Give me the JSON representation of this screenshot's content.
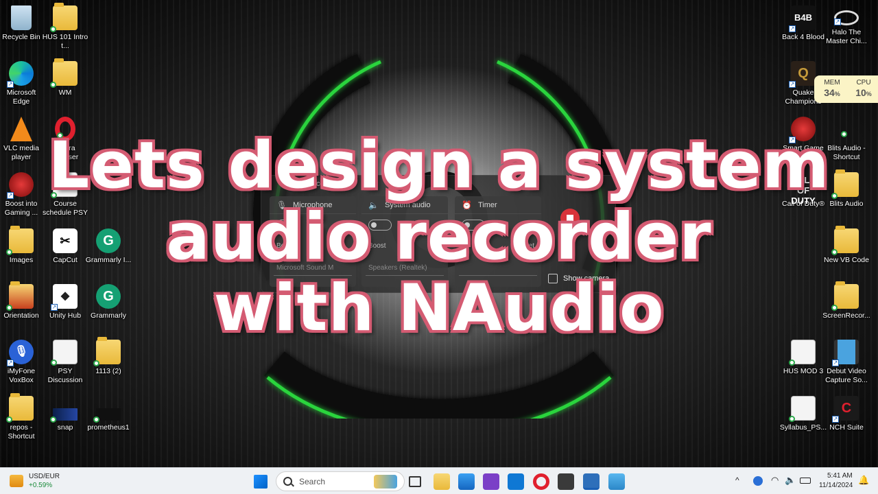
{
  "desktop": {
    "left_icons": [
      {
        "label": "Recycle Bin",
        "icon": "recycle-bin-icon"
      },
      {
        "label": "HUS 101 Intro t...",
        "icon": "folder-icon"
      },
      {
        "label": "Microsoft Edge",
        "icon": "edge-icon"
      },
      {
        "label": "WM",
        "icon": "folder-icon"
      },
      {
        "label": "VLC media player",
        "icon": "vlc-icon"
      },
      {
        "label": "Opera Browser",
        "icon": "opera-icon"
      },
      {
        "label": "Boost into Gaming ...",
        "icon": "game-booster-icon"
      },
      {
        "label": "Course schedule PSY",
        "icon": "document-icon"
      },
      {
        "label": "Images",
        "icon": "folder-icon"
      },
      {
        "label": "CapCut",
        "icon": "capcut-icon"
      },
      {
        "label": "Grammarly I...",
        "icon": "grammarly-icon"
      },
      {
        "label": "Orientation",
        "icon": "folder-icon"
      },
      {
        "label": "Unity Hub",
        "icon": "unity-icon"
      },
      {
        "label": "Grammarly",
        "icon": "grammarly-icon"
      },
      {
        "label": "iMyFone VoxBox",
        "icon": "voxbox-icon"
      },
      {
        "label": "PSY Discussion",
        "icon": "document-icon"
      },
      {
        "label": "1113 (2)",
        "icon": "folder-icon"
      },
      {
        "label": "repos - Shortcut",
        "icon": "folder-icon"
      },
      {
        "label": "snap",
        "icon": "image-icon"
      },
      {
        "label": "prometheus1",
        "icon": "image-icon"
      }
    ],
    "right_icons": [
      {
        "label": "Back 4 Blood",
        "icon": "back4blood-icon"
      },
      {
        "label": "Halo The Master Chi...",
        "icon": "halo-icon"
      },
      {
        "label": "Quake Champions",
        "icon": "quake-icon"
      },
      {
        "label": "Smart Game Booster",
        "icon": "game-booster-icon"
      },
      {
        "label": "Blits Audio - Shortcut",
        "icon": "blank-file-icon"
      },
      {
        "label": "Call of Duty®",
        "icon": "cod-icon"
      },
      {
        "label": "Blits Audio",
        "icon": "folder-icon"
      },
      {
        "label": "New VB Code",
        "icon": "folder-icon"
      },
      {
        "label": "ScreenRecor...",
        "icon": "folder-icon"
      },
      {
        "label": "HUS MOD 3",
        "icon": "document-icon"
      },
      {
        "label": "Debut Video Capture So...",
        "icon": "debut-icon"
      },
      {
        "label": "Syllabus_PS...",
        "icon": "document-icon"
      },
      {
        "label": "NCH Suite",
        "icon": "nch-icon"
      }
    ]
  },
  "recorder": {
    "title": "Screen Recorder",
    "panels": [
      {
        "label": "Microphone",
        "icon": "microphone-icon",
        "toggle": "OFF",
        "row2": "Boost",
        "dropdown": "Microsoft Sound M"
      },
      {
        "label": "System audio",
        "icon": "speaker-icon",
        "toggle": "OFF",
        "row2": "Boost",
        "dropdown": "Speakers (Realtek)"
      },
      {
        "label": "Timer",
        "icon": "alarm-clock-icon",
        "toggle": "OFF",
        "row2": "Set",
        "dropdown": ""
      }
    ],
    "show_camera": "Show camera"
  },
  "overlay": {
    "line1": "Lets design a system",
    "line2": "audio recorder",
    "line3": "with NAudio"
  },
  "perf": {
    "mem_label": "MEM",
    "mem_value": "34",
    "cpu_label": "CPU",
    "cpu_value": "10",
    "unit": "%"
  },
  "taskbar": {
    "widget_title": "USD/EUR",
    "widget_value": "+0.59%",
    "search_placeholder": "Search",
    "time": "5:41 AM",
    "date": "11/14/2024"
  },
  "colors": {
    "overlay_outline": "#d45b72",
    "accent_green": "#2bd43c",
    "record_red": "#d8333a"
  }
}
